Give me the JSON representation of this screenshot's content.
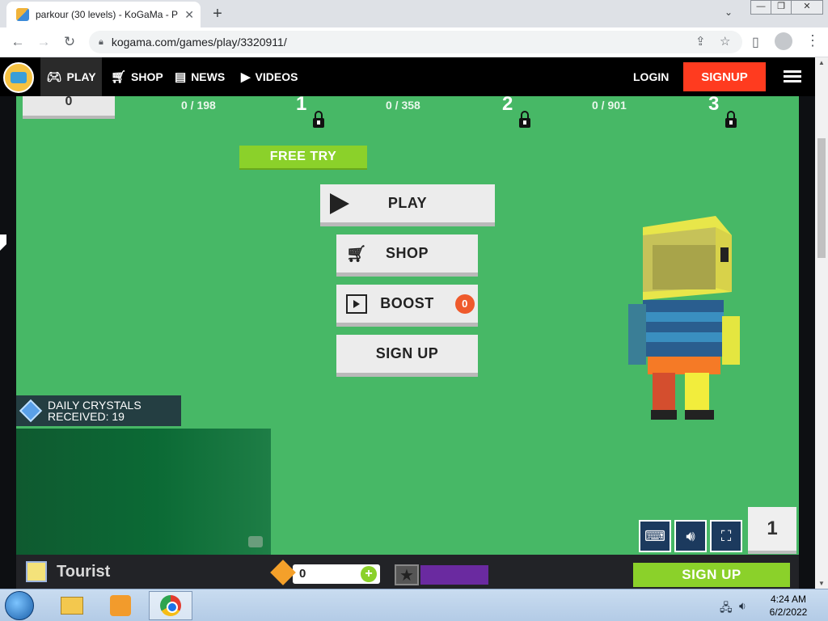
{
  "browser": {
    "tab_title": "parkour (30 levels) - KoGaMa - P",
    "tab_close": "✕",
    "new_tab": "+",
    "url": "kogama.com/games/play/3320911/",
    "window_controls": [
      "—",
      "❐",
      "✕"
    ]
  },
  "site_nav": {
    "items": [
      {
        "label": "PLAY",
        "icon": "gamepad-icon"
      },
      {
        "label": "SHOP",
        "icon": "cart-icon"
      },
      {
        "label": "NEWS",
        "icon": "newspaper-icon"
      },
      {
        "label": "VIDEOS",
        "icon": "youtube-icon"
      }
    ],
    "login": "LOGIN",
    "signup": "SIGNUP"
  },
  "game": {
    "counter": "0",
    "progress": [
      {
        "count": "0 / 198",
        "level": "1"
      },
      {
        "count": "0 / 358",
        "level": "2"
      },
      {
        "count": "0 / 901",
        "level": "3"
      }
    ],
    "free_try": "FREE TRY",
    "menu": {
      "play": "PLAY",
      "shop": "SHOP",
      "boost": "BOOST",
      "boost_badge": "0",
      "signup": "SIGN UP"
    },
    "daily_crystals_line1": "DAILY CRYSTALS",
    "daily_crystals_line2": "RECEIVED: 19",
    "current_level": "1"
  },
  "bottom_bar": {
    "username": "Tourist",
    "gold": "0",
    "signup": "SIGN UP"
  },
  "taskbar": {
    "time": "4:24 AM",
    "date": "6/2/2022"
  },
  "colors": {
    "game_green": "#47b866",
    "signup_red": "#ff3b1f",
    "lime": "#8bd12a",
    "xp_purple": "#6a2aa0"
  }
}
